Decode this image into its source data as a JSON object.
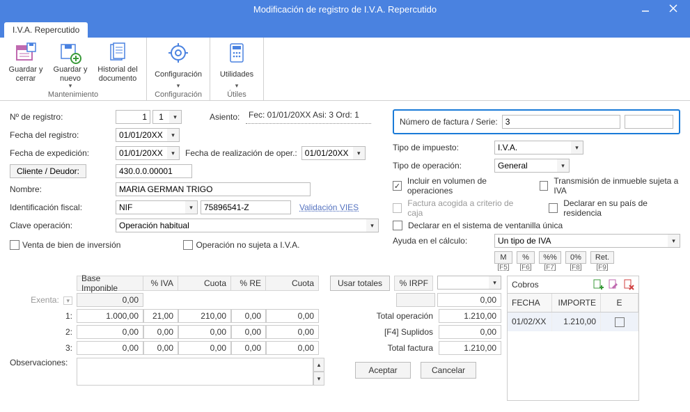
{
  "window": {
    "title": "Modificación de registro de I.V.A. Repercutido"
  },
  "tab": {
    "label": "I.V.A. Repercutido"
  },
  "ribbon": {
    "mantenimiento": {
      "title": "Mantenimiento",
      "guardar_cerrar": "Guardar y cerrar",
      "guardar_nuevo": "Guardar y nuevo",
      "historial": "Historial del documento"
    },
    "configuracion": {
      "title": "Configuración",
      "btn": "Configuración"
    },
    "utiles": {
      "title": "Útiles",
      "btn": "Utilidades"
    }
  },
  "left": {
    "n_registro_label": "Nº de registro:",
    "n_registro_val": "1",
    "n_registro_seq": "1",
    "asiento_label": "Asiento:",
    "asiento_val": "Fec: 01/01/20XX Asi: 3 Ord: 1",
    "fecha_registro_label": "Fecha del registro:",
    "fecha_registro_val": "01/01/20XX",
    "fecha_exped_label": "Fecha de expedición:",
    "fecha_exped_val": "01/01/20XX",
    "fecha_real_label": "Fecha de realización de oper.:",
    "fecha_real_val": "01/01/20XX",
    "cliente_btn": "Cliente / Deudor:",
    "cliente_val": "430.0.0.00001",
    "nombre_label": "Nombre:",
    "nombre_val": "MARIA GERMAN TRIGO",
    "id_fiscal_label": "Identificación fiscal:",
    "id_tipo": "NIF",
    "id_val": "75896541-Z",
    "vies": "Validación VIES",
    "clave_label": "Clave operación:",
    "clave_val": "Operación habitual",
    "venta_inversion": "Venta de bien de inversión",
    "op_no_sujeta": "Operación no sujeta a I.V.A."
  },
  "right": {
    "num_factura_label": "Número de factura / Serie:",
    "num_factura_val": "3",
    "tipo_impuesto_label": "Tipo de impuesto:",
    "tipo_impuesto_val": "I.V.A.",
    "tipo_operacion_label": "Tipo de operación:",
    "tipo_operacion_val": "General",
    "incluir_volumen": "Incluir en volumen de operaciones",
    "transmision_inmueble": "Transmisión de inmueble sujeta a IVA",
    "factura_caja": "Factura acogida a criterio de caja",
    "declarar_pais": "Declarar en su país de residencia",
    "declarar_ventanilla": "Declarar en el sistema de ventanilla única",
    "ayuda_label": "Ayuda en el cálculo:",
    "ayuda_val": "Un tipo de IVA",
    "helper_btns": {
      "m": "M",
      "pct": "%",
      "pctpct": "%%",
      "zero": "0%",
      "ret": "Ret."
    },
    "helper_keys": {
      "m": "[F5]",
      "pct": "[F6]",
      "pctpct": "[F7]",
      "zero": "[F8]",
      "ret": "[F9]"
    }
  },
  "grid": {
    "headers": {
      "base": "Base Imponible",
      "piva": "% IVA",
      "cuota": "Cuota",
      "pre": "% RE",
      "cuota2": "Cuota",
      "usar": "Usar totales",
      "pirpf": "% IRPF"
    },
    "exenta_label": "Exenta:",
    "rows": [
      {
        "label": "1:",
        "base": "1.000,00",
        "piva": "21,00",
        "cuota": "210,00",
        "pre": "0,00",
        "cuota2": "0,00"
      },
      {
        "label": "2:",
        "base": "0,00",
        "piva": "0,00",
        "cuota": "0,00",
        "pre": "0,00",
        "cuota2": "0,00"
      },
      {
        "label": "3:",
        "base": "0,00",
        "piva": "0,00",
        "cuota": "0,00",
        "pre": "0,00",
        "cuota2": "0,00"
      }
    ],
    "exenta_base": "0,00",
    "irpf_cuota": "0,00",
    "totals": {
      "total_op_label": "Total operación",
      "total_op": "1.210,00",
      "suplidos_label": "[F4] Suplidos",
      "suplidos": "0,00",
      "total_fact_label": "Total factura",
      "total_fact": "1.210,00"
    },
    "observ_label": "Observaciones:"
  },
  "cobros": {
    "title": "Cobros",
    "cols": {
      "fecha": "FECHA",
      "importe": "IMPORTE",
      "e": "E"
    },
    "rows": [
      {
        "fecha": "01/02/XX",
        "importe": "1.210,00"
      }
    ]
  },
  "footer": {
    "aceptar": "Aceptar",
    "cancelar": "Cancelar"
  }
}
